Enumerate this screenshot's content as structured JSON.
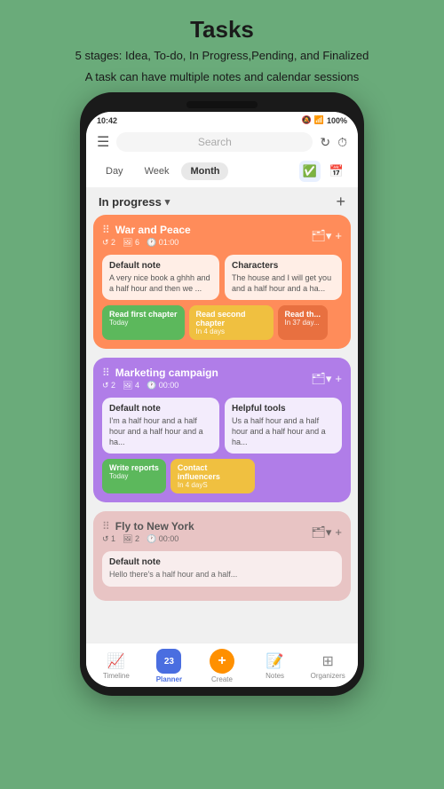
{
  "header": {
    "title": "Tasks",
    "subtitle_line1": "5 stages: Idea, To-do, In Progress,Pending, and Finalized",
    "subtitle_line2": "A task can have multiple notes and calendar sessions"
  },
  "status_bar": {
    "time": "10:42",
    "battery": "100%"
  },
  "top_bar": {
    "search_placeholder": "Search",
    "menu_icon": "☰",
    "refresh_icon": "↻",
    "timer_icon": "⏱"
  },
  "period_tabs": {
    "tabs": [
      {
        "label": "Day",
        "active": false
      },
      {
        "label": "Week",
        "active": false
      },
      {
        "label": "Month",
        "active": true
      }
    ],
    "icon_check": "✅",
    "icon_calendar": "📅"
  },
  "section": {
    "title": "In progress",
    "arrow": "▾",
    "add": "+"
  },
  "tasks": [
    {
      "id": "war-peace",
      "color_class": "task-card-orange",
      "title": "War and Peace",
      "meta": [
        {
          "icon": "↺",
          "value": "2"
        },
        {
          "icon": "🖼",
          "value": "6"
        },
        {
          "icon": "🕐",
          "value": "01:00"
        }
      ],
      "notes": [
        {
          "title": "Default note",
          "text": "A very nice book a ghhh and a half hour and then we ..."
        },
        {
          "title": "Characters",
          "text": "The house and I will get you and a half hour and a ha..."
        }
      ],
      "sessions": [
        {
          "label": "Read first chapter",
          "sub": "Today",
          "color_class": "pill-green"
        },
        {
          "label": "Read second chapter",
          "sub": "In 4 days",
          "color_class": "pill-yellow"
        },
        {
          "label": "Read th...",
          "sub": "In 37 day...",
          "color_class": "pill-red"
        }
      ]
    },
    {
      "id": "marketing",
      "color_class": "task-card-purple",
      "title": "Marketing campaign",
      "meta": [
        {
          "icon": "↺",
          "value": "2"
        },
        {
          "icon": "🖼",
          "value": "4"
        },
        {
          "icon": "🕐",
          "value": "00:00"
        }
      ],
      "notes": [
        {
          "title": "Default note",
          "text": "I'm a half hour and a half hour and a half hour and a ha..."
        },
        {
          "title": "Helpful tools",
          "text": "Us a half hour and a half hour and a half hour and a ha..."
        }
      ],
      "sessions": [
        {
          "label": "Write reports",
          "sub": "Today",
          "color_class": "pill-green"
        },
        {
          "label": "Contact influencers",
          "sub": "In 4 dayS",
          "color_class": "pill-yellow"
        }
      ]
    },
    {
      "id": "fly-newyork",
      "color_class": "task-card-pink",
      "title": "Fly to New York",
      "meta": [
        {
          "icon": "↺",
          "value": "1"
        },
        {
          "icon": "🖼",
          "value": "2"
        },
        {
          "icon": "🕐",
          "value": "00:00"
        }
      ],
      "notes": [
        {
          "title": "Default note",
          "text": "Hello there's a half hour and a half..."
        }
      ],
      "sessions": []
    }
  ],
  "bottom_nav": [
    {
      "id": "timeline",
      "icon": "📈",
      "label": "Timeline",
      "active": false
    },
    {
      "id": "planner",
      "icon": "23",
      "label": "Planner",
      "active": true
    },
    {
      "id": "create",
      "icon": "+",
      "label": "Create",
      "active": false
    },
    {
      "id": "notes",
      "icon": "📝",
      "label": "Notes",
      "active": false
    },
    {
      "id": "organizers",
      "icon": "⊞",
      "label": "Organizers",
      "active": false
    }
  ]
}
